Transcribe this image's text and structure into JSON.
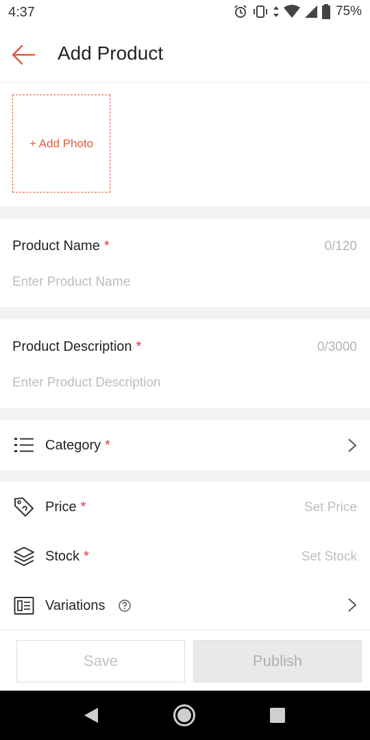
{
  "status_bar": {
    "time": "4:37",
    "battery": "75%"
  },
  "header": {
    "title": "Add Product"
  },
  "photo": {
    "add_label": "+ Add Photo"
  },
  "product_name": {
    "label": "Product Name",
    "required": "*",
    "counter": "0/120",
    "placeholder": "Enter Product Name"
  },
  "product_description": {
    "label": "Product Description",
    "required": "*",
    "counter": "0/3000",
    "placeholder": "Enter Product Description"
  },
  "category": {
    "label": "Category",
    "required": "*"
  },
  "price": {
    "label": "Price",
    "required": "*",
    "value": "Set Price"
  },
  "stock": {
    "label": "Stock",
    "required": "*",
    "value": "Set Stock"
  },
  "variations": {
    "label": "Variations"
  },
  "footer": {
    "save_label": "Save",
    "publish_label": "Publish"
  },
  "colors": {
    "accent": "#e05a3a",
    "required": "#e0383e",
    "placeholder": "#bdbdbd",
    "divider": "#f2f2f2"
  },
  "icons": [
    "alarm-icon",
    "vibrate-icon",
    "wifi-icon",
    "signal-icon",
    "battery-icon",
    "back-arrow-icon",
    "list-icon",
    "tag-icon",
    "layers-icon",
    "variations-icon",
    "help-icon",
    "chevron-right-icon",
    "nav-back-icon",
    "nav-home-icon",
    "nav-recents-icon"
  ]
}
